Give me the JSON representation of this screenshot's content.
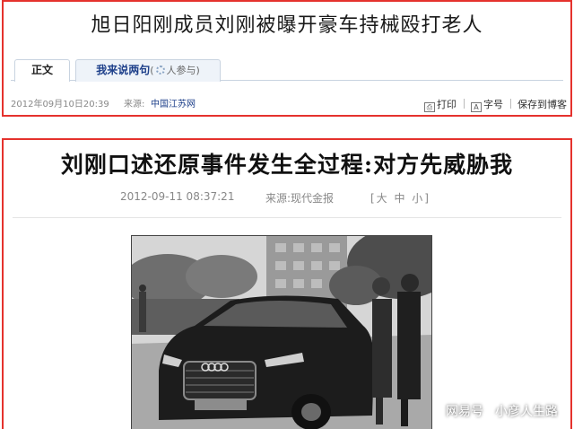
{
  "article1": {
    "headline": "旭日阳刚成员刘刚被曝开豪车持械殴打老人",
    "tabs": [
      {
        "label": "正文"
      },
      {
        "label": "我来说两句",
        "comment_count": "人参与"
      }
    ],
    "date": "2012年09月10日20:39",
    "source_label": "来源:",
    "source": "中国江苏网",
    "tools": {
      "print": "打印",
      "fontsize": "字号",
      "save": "保存到博客"
    }
  },
  "article2": {
    "headline": "刘刚口述还原事件发生全过程:对方先威胁我",
    "date": "2012-09-11 08:37:21",
    "source": "来源:现代金报",
    "fontsize_ctl": "[大 中 小]"
  },
  "watermark": {
    "brand": "网易号",
    "author": "小彦人生路"
  },
  "colors": {
    "highlight_border": "#e5322d",
    "link_blue": "#1d3f8a"
  },
  "icons": [
    "print-icon",
    "fontsize-icon",
    "loading-icon"
  ]
}
